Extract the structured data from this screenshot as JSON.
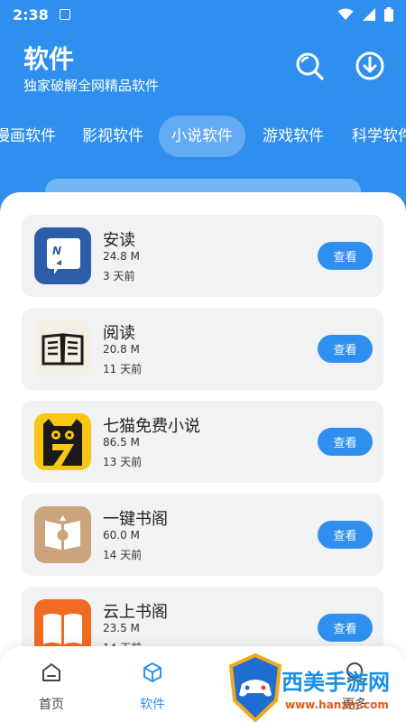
{
  "status_bar": {
    "time": "2:38"
  },
  "header": {
    "title": "软件",
    "subtitle": "独家破解全网精品软件",
    "icons": [
      "search-icon",
      "download-icon"
    ]
  },
  "tabs": [
    {
      "label": "漫画软件",
      "active": false
    },
    {
      "label": "影视软件",
      "active": false
    },
    {
      "label": "小说软件",
      "active": true
    },
    {
      "label": "游戏软件",
      "active": false
    },
    {
      "label": "科学软件",
      "active": false
    }
  ],
  "apps": [
    {
      "name": "安读",
      "size": "24.8 M",
      "time": "3 天前",
      "button": "查看",
      "icon": "book-n-icon"
    },
    {
      "name": "阅读",
      "size": "20.8 M",
      "time": "11 天前",
      "button": "查看",
      "icon": "open-book-icon"
    },
    {
      "name": "七猫免费小说",
      "size": "86.5 M",
      "time": "13 天前",
      "button": "查看",
      "icon": "cat-seven-icon"
    },
    {
      "name": "一键书阁",
      "size": "60.0 M",
      "time": "14 天前",
      "button": "查看",
      "icon": "book-pavilion-icon"
    },
    {
      "name": "云上书阁",
      "size": "23.5 M",
      "time": "14 天前",
      "button": "查看",
      "icon": "orange-book-icon"
    }
  ],
  "bottom_nav": [
    {
      "label": "首页",
      "icon": "home-icon",
      "active": false
    },
    {
      "label": "软件",
      "icon": "cube-icon",
      "active": true
    },
    {
      "label": "",
      "icon": "compass-icon",
      "active": false
    },
    {
      "label": "更多",
      "icon": "person-icon",
      "active": false
    }
  ],
  "watermark": {
    "text": "西美手游网",
    "url": "www.hanxm.com"
  },
  "colors": {
    "primary": "#2f8fee",
    "card_bg": "#f1f2f4"
  }
}
